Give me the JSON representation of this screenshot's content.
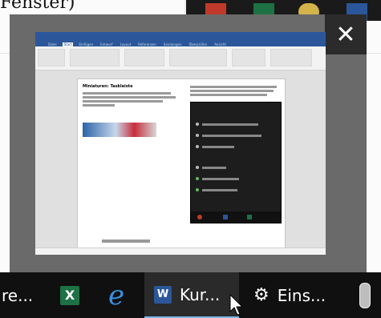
{
  "background": {
    "title_fragment": "Fenster)"
  },
  "thumbnail": {
    "close_label": "✕",
    "doc": {
      "ribbon_tabs": [
        "Datei",
        "Start",
        "Einfügen",
        "Entwurf",
        "Layout",
        "Referenzen",
        "Sendungen",
        "Überprüfen",
        "Ansicht"
      ],
      "heading": "Miniaturen: Taskleiste"
    }
  },
  "taskbar": {
    "items": [
      {
        "label": "re..."
      },
      {
        "label": ""
      },
      {
        "label": ""
      },
      {
        "label": "Kur..."
      },
      {
        "label": "Eins..."
      }
    ]
  },
  "colors": {
    "taskbar_bg": "#101010",
    "word_blue": "#2b579a",
    "excel_green": "#1e7145",
    "active_underline": "#76b9ed"
  }
}
